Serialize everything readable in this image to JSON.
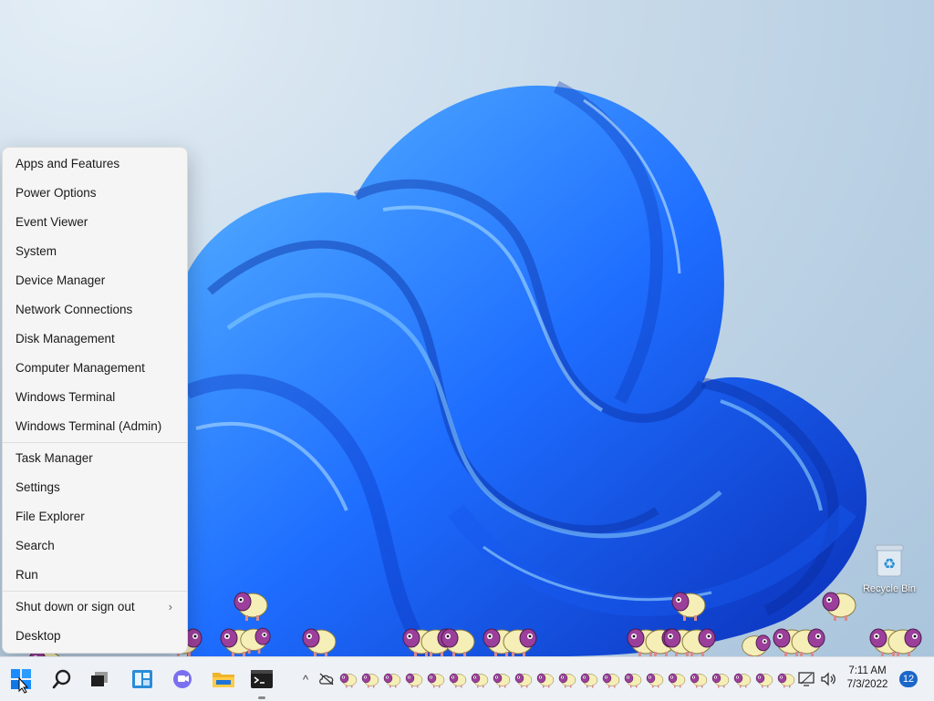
{
  "desktop": {
    "recycle_bin_label": "Recycle Bin"
  },
  "quick_link_menu": {
    "group1": [
      "Apps and Features",
      "Power Options",
      "Event Viewer",
      "System",
      "Device Manager",
      "Network Connections",
      "Disk Management",
      "Computer Management",
      "Windows Terminal",
      "Windows Terminal (Admin)"
    ],
    "group2": [
      "Task Manager",
      "Settings",
      "File Explorer",
      "Search",
      "Run"
    ],
    "group3": [
      "Shut down or sign out",
      "Desktop"
    ],
    "submenu_chevron": "›"
  },
  "taskbar": {
    "apps": [
      "start-icon",
      "search-icon",
      "task-view-icon",
      "widgets-icon",
      "teams-chat-icon",
      "file-explorer-icon",
      "terminal-icon"
    ],
    "tray_expand_glyph": "^",
    "clock_time": "7:11 AM",
    "clock_date": "7/3/2022",
    "notification_count": "12"
  },
  "colors": {
    "accent": "#1a66c9",
    "bloom_dark": "#0a3fd0",
    "bloom_light": "#4aa8ff",
    "menu_bg": "#f5f5f5",
    "taskbar_bg": "#eef1f6",
    "sheep_wool": "#f5eeb6",
    "sheep_face": "#9b3f9a"
  }
}
